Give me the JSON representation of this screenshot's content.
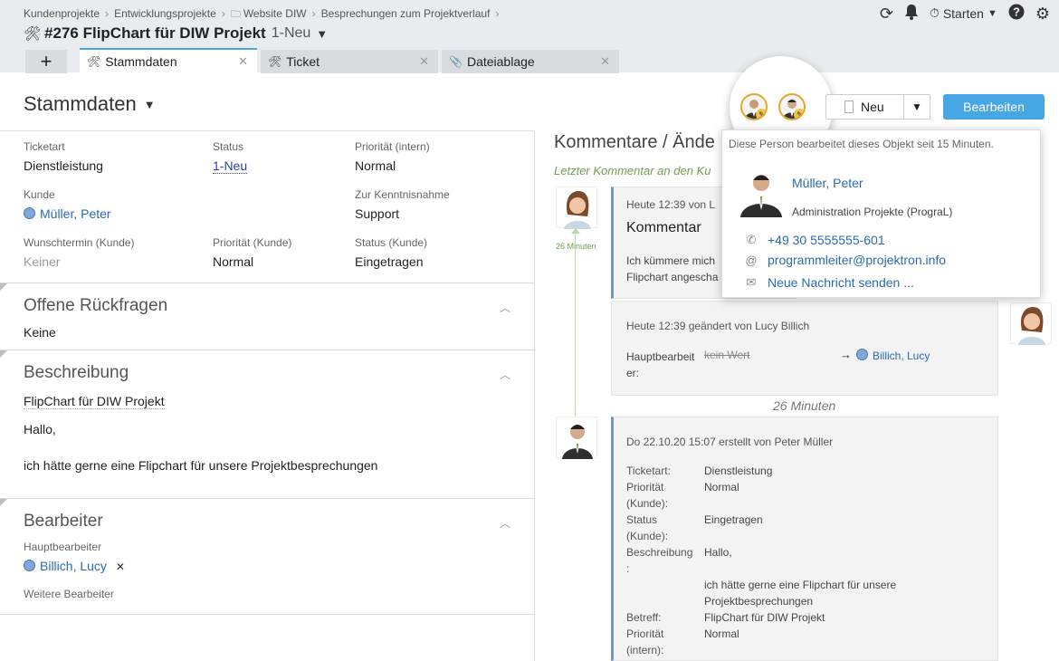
{
  "breadcrumb": [
    {
      "label": "Kundenprojekte"
    },
    {
      "label": "Entwicklungsprojekte"
    },
    {
      "label": "Website DIW",
      "icon": "folder-icon"
    },
    {
      "label": "Besprechungen zum Projektverlauf"
    }
  ],
  "header": {
    "title": "#276 FlipChart für DIW Projekt",
    "status": "1-Neu",
    "starten_label": "Starten"
  },
  "tabs": [
    {
      "label": "Stammdaten",
      "active": true
    },
    {
      "label": "Ticket",
      "active": false
    },
    {
      "label": "Dateiablage",
      "active": false
    }
  ],
  "page": {
    "title": "Stammdaten",
    "select_value": "Neu",
    "edit_button": "Bearbeiten"
  },
  "fields": {
    "ticketart": {
      "label": "Ticketart",
      "value": "Dienstleistung"
    },
    "status": {
      "label": "Status",
      "value": "1-Neu"
    },
    "prioritaet_intern": {
      "label": "Priorität (intern)",
      "value": "Normal"
    },
    "kunde": {
      "label": "Kunde",
      "value": "Müller, Peter"
    },
    "kenntnisnahme": {
      "label": "Zur Kenntnisnahme",
      "value": "Support"
    },
    "wunschtermin": {
      "label": "Wunschtermin (Kunde)",
      "value": "Keiner"
    },
    "prioritaet_kunde": {
      "label": "Priorität (Kunde)",
      "value": "Normal"
    },
    "status_kunde": {
      "label": "Status (Kunde)",
      "value": "Eingetragen"
    }
  },
  "sections": {
    "rueckfragen": {
      "title": "Offene Rückfragen",
      "body": "Keine"
    },
    "beschreibung": {
      "title": "Beschreibung",
      "subject": "FlipChart für DIW Projekt",
      "line1": "Hallo,",
      "line2": "ich hätte gerne eine Flipchart für unsere Projektbesprechungen"
    },
    "bearbeiter": {
      "title": "Bearbeiter",
      "haupt_label": "Hauptbearbeiter",
      "haupt_value": "Billich, Lucy",
      "weitere_label": "Weitere Bearbeiter"
    }
  },
  "comments": {
    "title": "Kommentare / Ände",
    "subtitle": "Letzter Kommentar an den Ku",
    "timeline_label": "26 Minuten",
    "card1": {
      "head": "Heute 12:39 von L",
      "title": "Kommentar",
      "text1": "Ich kümmere mich",
      "text2": "Flipchart angescha"
    },
    "card2": {
      "head": "Heute 12:39 geändert von Lucy Billich",
      "key": "Hauptbearbeit",
      "key2": "er:",
      "old": "kein Wert",
      "arrow": "→",
      "new": "Billich, Lucy"
    },
    "gap_label": "26 Minuten",
    "card3": {
      "head": "Do 22.10.20 15:07 erstellt von Peter Müller",
      "rows": [
        {
          "k": "Ticketart:",
          "v": "Dienstleistung"
        },
        {
          "k": "Priorität",
          "v": "Normal"
        },
        {
          "k": "(Kunde):",
          "v": ""
        },
        {
          "k": "Status",
          "v": "Eingetragen"
        },
        {
          "k": "(Kunde):",
          "v": ""
        },
        {
          "k": "Beschreibung",
          "v": "Hallo,"
        },
        {
          "k": ":",
          "v": ""
        },
        {
          "k": "",
          "v": "ich hätte gerne eine Flipchart für unsere"
        },
        {
          "k": "",
          "v": "Projektbesprechungen"
        },
        {
          "k": "Betreff:",
          "v": "FlipChart für DIW Projekt"
        },
        {
          "k": "Priorität",
          "v": "Normal"
        },
        {
          "k": "(intern):",
          "v": ""
        }
      ]
    }
  },
  "popup": {
    "message": "Diese Person bearbeitet dieses Objekt seit 15 Minuten.",
    "name": "Müller, Peter",
    "role": "Administration Projekte (PrograL)",
    "phone": "+49 30 5555555-601",
    "email": "programmleiter@projektron.info",
    "send": "Neue Nachricht senden ..."
  },
  "colors": {
    "accent": "#47a7e4",
    "link": "#2a6ab0",
    "header_bg": "#e9ebee",
    "timeline_green": "#6e9f51"
  }
}
